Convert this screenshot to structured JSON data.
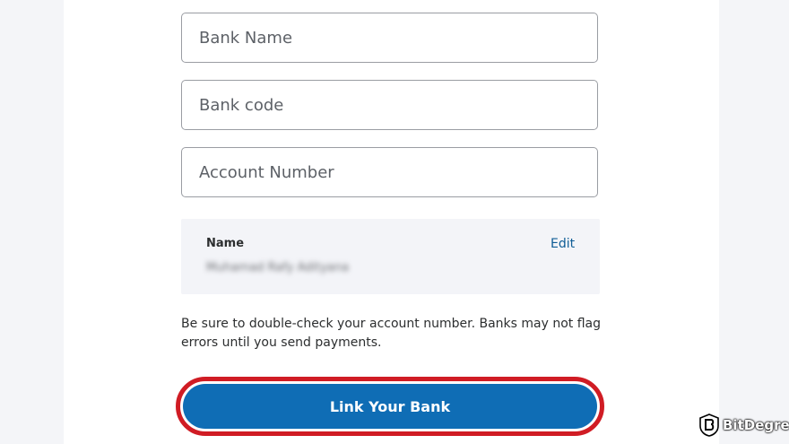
{
  "form": {
    "bank_name_placeholder": "Bank Name",
    "bank_code_placeholder": "Bank code",
    "account_number_placeholder": "Account Number"
  },
  "name_box": {
    "label": "Name",
    "edit_label": "Edit",
    "value": "Muhamad Rafy Adityana"
  },
  "note": "Be sure to double-check your account number. Banks may not flag errors until you send payments.",
  "link_button_label": "Link Your Bank",
  "watermark": "BitDegree",
  "colors": {
    "button": "#0f6db5",
    "highlight_outline": "#d01c24",
    "edit_link": "#0f5d96"
  }
}
